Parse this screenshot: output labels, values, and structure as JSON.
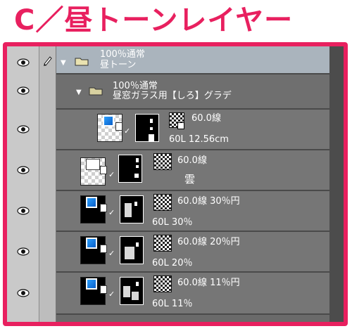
{
  "title": "C／昼トーンレイヤー",
  "folder1": {
    "mode": "100％通常",
    "name": "昼トーン"
  },
  "folder2": {
    "mode": "100％通常",
    "name": "昼窓ガラス用【しろ】グラデ"
  },
  "layers": [
    {
      "tone": "60.0線",
      "sub": "60L 12.56cm"
    },
    {
      "tone": "60.0線",
      "sub": "雲"
    },
    {
      "tone": "60.0線 30％円",
      "sub": "60L 30％"
    },
    {
      "tone": "60.0線 20％円",
      "sub": "60L 20％"
    },
    {
      "tone": "60.0線 11％円",
      "sub": "60L 11％"
    }
  ],
  "icons": [
    "eye-icon",
    "pen-icon",
    "folder-icon",
    "expand-triangle-icon",
    "mask-link-icon"
  ],
  "colors": {
    "accent": "#e8205f",
    "panel": "#6a6a6a",
    "folder_header": "#aab4bd"
  }
}
